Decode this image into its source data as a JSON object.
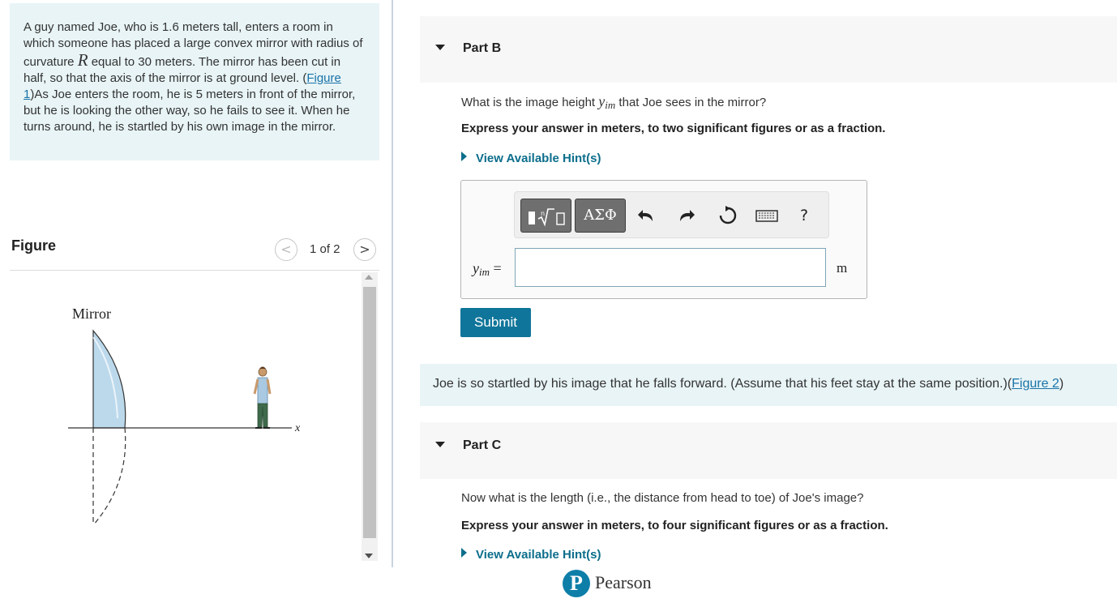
{
  "problem": {
    "text_1": "A guy named Joe, who is 1.6 meters tall, enters a room in which someone has placed a large convex mirror with radius of curvature ",
    "var_R": "R",
    "text_2": " equal to 30 meters. The mirror has been cut in half, so that the axis of the mirror is at ground level. (",
    "figure_link": "Figure 1",
    "text_3": ")As Joe enters the room, he is 5 meters in front of the mirror, but he is looking the other way, so he fails to see it. When he turns around, he is startled by his own image in the mirror."
  },
  "figure_panel": {
    "title": "Figure",
    "prev_icon": "chevron-left-icon",
    "next_icon": "chevron-right-icon",
    "prev_glyph": "<",
    "next_glyph": ">",
    "counter": "1 of 2",
    "mirror_label": "Mirror",
    "axis_label": "x"
  },
  "part_b": {
    "label": "Part B",
    "question_pre": "What is the image height ",
    "var": "y",
    "var_sub": "im",
    "question_post": " that Joe sees in the mirror?",
    "instruction": "Express your answer in meters, to two significant figures or as a fraction.",
    "hint_link": "View Available Hint(s)",
    "toolbar": {
      "greek_label": "ΑΣΦ",
      "undo_icon": "undo-icon",
      "redo_icon": "redo-icon",
      "reset_icon": "reset-icon",
      "keyboard_icon": "keyboard-icon",
      "help_label": "?"
    },
    "answer_label_var": "y",
    "answer_label_sub": "im",
    "answer_label_eq": " =",
    "answer_value": "",
    "unit": "m",
    "submit_label": "Submit"
  },
  "info": {
    "text": "Joe is so startled by his image that he falls forward. (Assume that his feet stay at the same position.)(",
    "figure_link": "Figure 2",
    "text_end": ")"
  },
  "part_c": {
    "label": "Part C",
    "question": "Now what is the length (i.e., the distance from head to toe) of Joe's image?",
    "instruction": "Express your answer in meters, to four significant figures or as a fraction.",
    "hint_link": "View Available Hint(s)"
  },
  "footer": {
    "logo_letter": "P",
    "brand": "Pearson"
  },
  "colors": {
    "accent": "#10759a",
    "info_bg": "#e8f4f6",
    "link": "#1a73a8",
    "mirror_fill": "#bcd9ec"
  }
}
